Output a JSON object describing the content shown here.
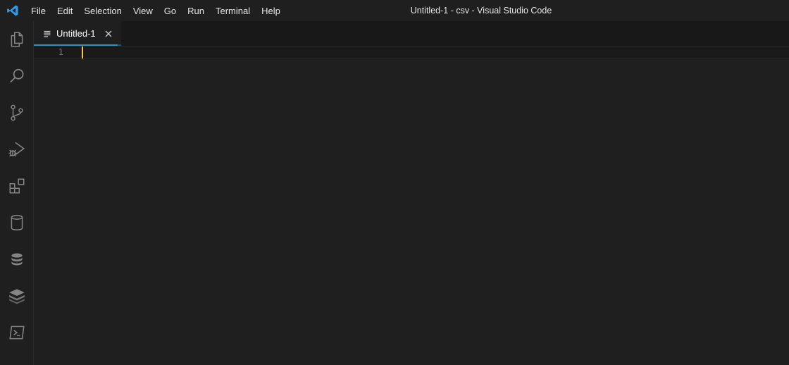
{
  "window": {
    "title": "Untitled-1 - csv - Visual Studio Code"
  },
  "menubar": {
    "items": [
      "File",
      "Edit",
      "Selection",
      "View",
      "Go",
      "Run",
      "Terminal",
      "Help"
    ]
  },
  "activitybar": {
    "items": [
      {
        "icon": "files-icon"
      },
      {
        "icon": "search-icon"
      },
      {
        "icon": "source-control-icon"
      },
      {
        "icon": "run-debug-icon"
      },
      {
        "icon": "extensions-icon"
      },
      {
        "icon": "database-icon"
      },
      {
        "icon": "database-stack-icon"
      },
      {
        "icon": "layers-icon"
      },
      {
        "icon": "terminal-icon"
      }
    ]
  },
  "editor": {
    "tabs": [
      {
        "label": "Untitled-1",
        "active": true
      }
    ],
    "line_numbers": [
      "1"
    ]
  },
  "colors": {
    "accent": "#2d8fbd",
    "cursor": "#f2c94c",
    "logo": "#2f9be9"
  }
}
